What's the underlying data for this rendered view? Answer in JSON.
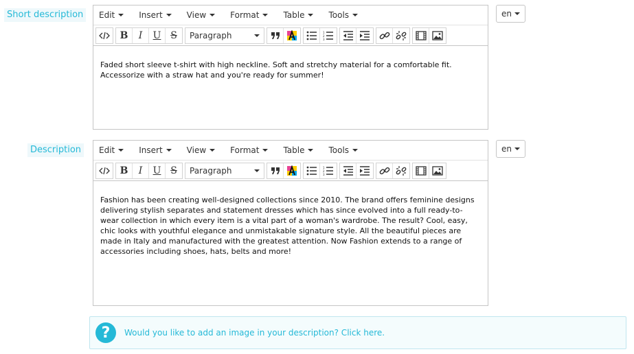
{
  "short_description": {
    "label": "Short description",
    "menus": [
      "Edit",
      "Insert",
      "View",
      "Format",
      "Table",
      "Tools"
    ],
    "block_format": "Paragraph",
    "text": "Faded short sleeve t-shirt with high neckline. Soft and stretchy material for a comfortable fit. Accessorize with a straw hat and you're ready for summer!",
    "language": "en"
  },
  "description": {
    "label": "Description",
    "menus": [
      "Edit",
      "Insert",
      "View",
      "Format",
      "Table",
      "Tools"
    ],
    "block_format": "Paragraph",
    "text": "Fashion has been creating well-designed collections since 2010. The brand offers feminine designs delivering stylish separates and statement dresses which has since evolved into a full ready-to-wear collection in which every item is a vital part of a woman's wardrobe. The result? Cool, easy, chic looks with youthful elegance and unmistakable signature style. All the beautiful pieces are made in Italy and manufactured with the greatest attention. Now Fashion extends to a range of accessories including shoes, hats, belts and more!",
    "language": "en"
  },
  "toolbar": {
    "bold": "B",
    "italic": "I",
    "underline": "U",
    "strikethrough": "S"
  },
  "help_alert": {
    "icon": "?",
    "text": "Would you like to add an image in your description? Click here."
  }
}
